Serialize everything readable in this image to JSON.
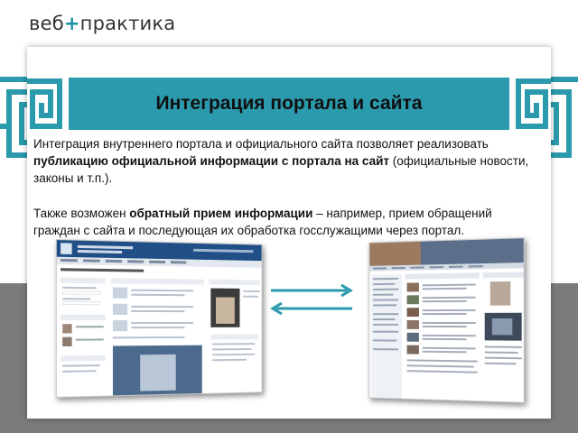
{
  "logo": {
    "part1": "веб",
    "plus": "+",
    "part2": "практика"
  },
  "slide": {
    "title": "Интеграция портала и сайта",
    "p1_a": "Интеграция внутреннего портала и официального сайта позволяет реализовать ",
    "p1_b": "публикацию официальной информации с портала на сайт",
    "p1_c": " (официальные новости, законы и т.п.).",
    "p2_a": "Также возможен ",
    "p2_b": "обратный прием информации",
    "p2_c": " – например, прием обращений граждан с сайта и последующая их обработка госслужащими через портал."
  },
  "colors": {
    "accent": "#2b9aad",
    "band": "#7b7b7b",
    "plus": "#1f8fa6"
  },
  "icons": [
    "arrow-right-icon",
    "arrow-left-icon",
    "greek-key-ornament"
  ]
}
